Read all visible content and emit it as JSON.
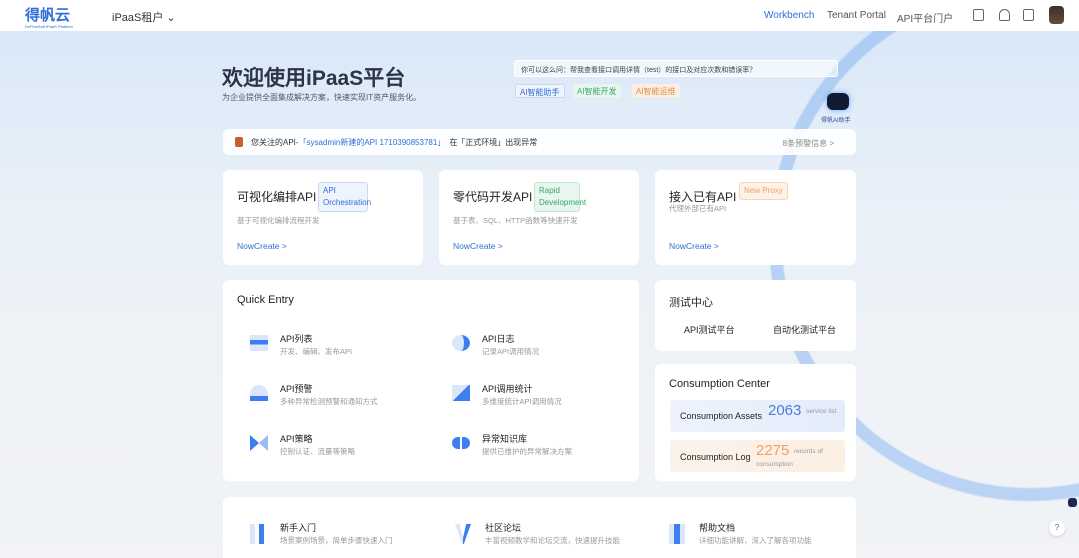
{
  "header": {
    "logo": "得帆云",
    "logo_sub": "DeFineSoft iPaaS Platform",
    "tenant": "iPaaS租户",
    "nav": [
      "Workbench",
      "Tenant Portal",
      "API平台门户"
    ],
    "icons": [
      "clipboard-icon",
      "bell-icon",
      "document-icon",
      "avatar"
    ]
  },
  "hero": {
    "title": "欢迎使用iPaaS平台",
    "subtitle": "为企业提供全面集成解决方案，快速实现IT资产服务化。",
    "ai_question": "你可以这么问：帮我查看接口调用详情（test）的接口及对应次数和错误率？",
    "ai_tags": [
      "AI智能助手",
      "AI智能开发",
      "AI智能运维"
    ],
    "robot_label": "得帆AI助手"
  },
  "notice": {
    "prefix": "您关注的API-",
    "link": "「sysadmin新建的API 1710390853781」",
    "suffix": "在「正式环境」出现异常",
    "more": "8条预警信息 >"
  },
  "create_cards": [
    {
      "title": "可视化编排API",
      "badge": "API Orchestration",
      "desc": "基于可视化编排流程开发",
      "action": "NowCreate >"
    },
    {
      "title": "零代码开发API",
      "badge": "Rapid Development",
      "desc": "基于表、SQL、HTTP函数等快速开发",
      "action": "NowCreate >"
    },
    {
      "title": "接入已有API",
      "badge": "New Proxy",
      "desc": "代理外部已有API",
      "action": "NowCreate >"
    }
  ],
  "quick_entry": {
    "title": "Quick Entry",
    "items": [
      {
        "title": "API列表",
        "desc": "开发、编辑、发布API"
      },
      {
        "title": "API日志",
        "desc": "记录API调用情况"
      },
      {
        "title": "API预警",
        "desc": "多种异常检测预警和通知方式"
      },
      {
        "title": "API调用统计",
        "desc": "多维度统计API调用情况"
      },
      {
        "title": "API策略",
        "desc": "控制认证、流量等策略"
      },
      {
        "title": "异常知识库",
        "desc": "提供已维护的异常解决方案"
      }
    ]
  },
  "test_center": {
    "title": "测试中心",
    "items": [
      "API测试平台",
      "自动化测试平台"
    ]
  },
  "consumption": {
    "title": "Consumption Center",
    "assets_label": "Consumption Assets",
    "assets_value": "2063",
    "assets_unit": "service list",
    "log_label": "Consumption Log",
    "log_value": "2275",
    "log_unit": "records of consumption"
  },
  "help": {
    "items": [
      {
        "title": "新手入门",
        "desc": "场景案例场景，简单步骤快速入门"
      },
      {
        "title": "社区论坛",
        "desc": "丰富视频教学和论坛交流，快速提升技能"
      },
      {
        "title": "帮助文档",
        "desc": "详细功能讲解，深入了解各项功能"
      }
    ]
  },
  "colors": {
    "accent": "#2f6fd6",
    "orange": "#f0a060",
    "green": "#3aa66a"
  }
}
